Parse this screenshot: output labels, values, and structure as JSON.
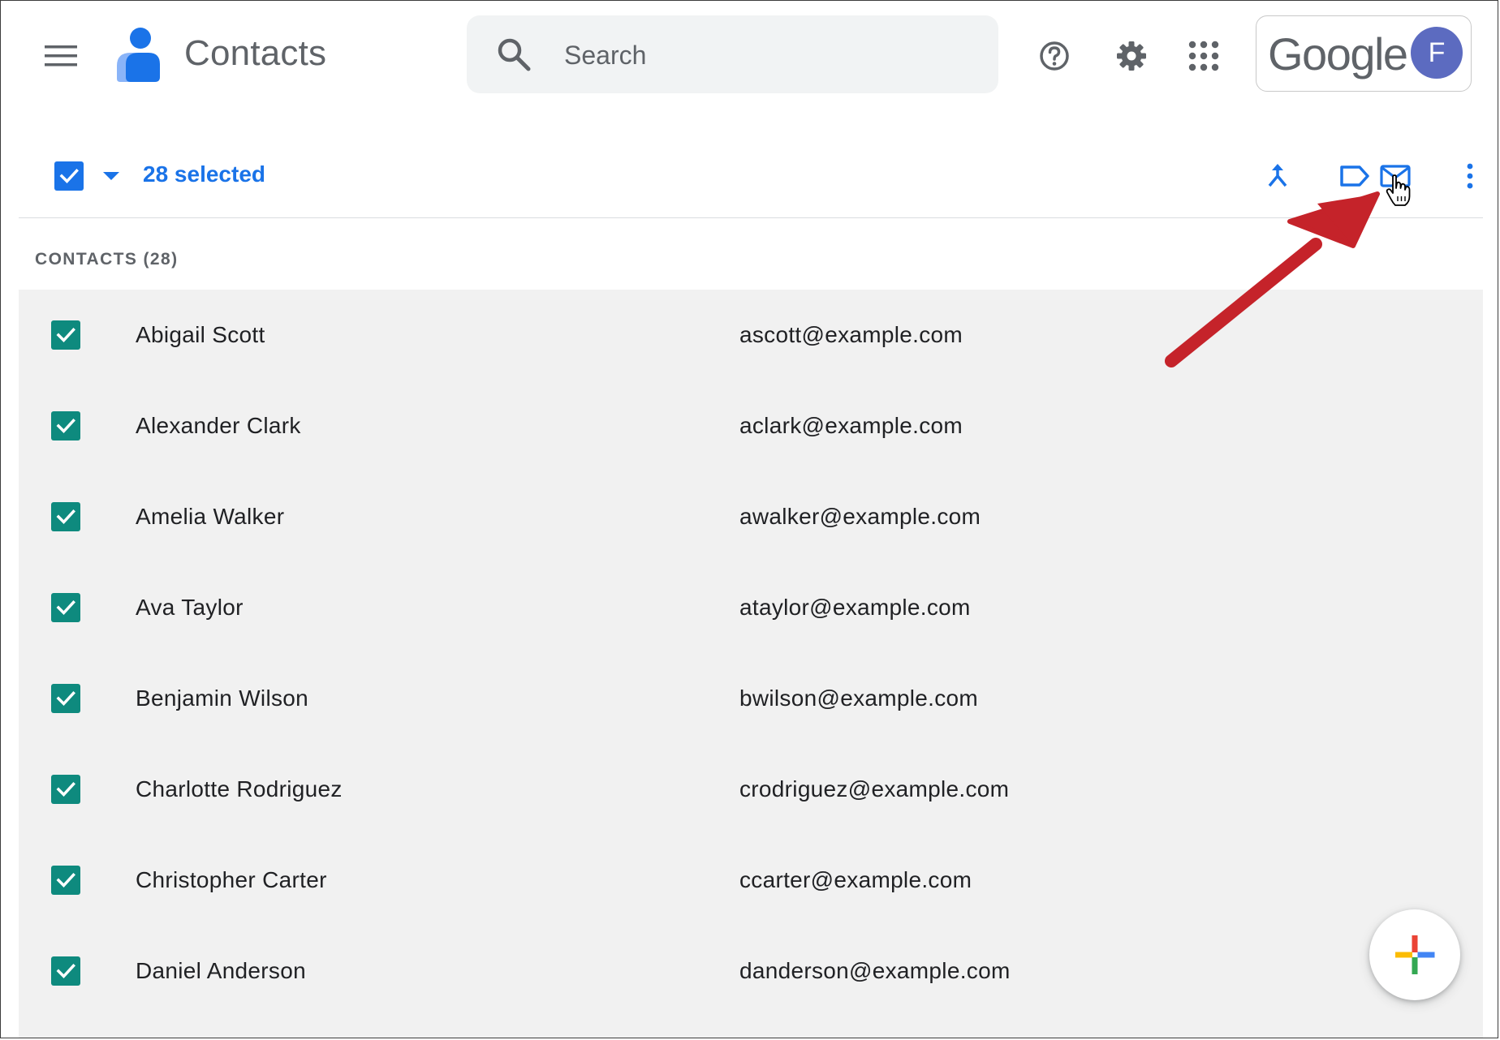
{
  "header": {
    "app_title": "Contacts",
    "brand_word": "Google",
    "avatar_initial": "F",
    "menu_icon": "hamburger-menu-icon",
    "logo_icon": "contacts-person-icon",
    "help_icon": "help-circle-icon",
    "settings_icon": "gear-icon",
    "apps_icon": "apps-grid-icon"
  },
  "search": {
    "placeholder": "Search",
    "value": ""
  },
  "selection": {
    "count_label": "28 selected",
    "actions": [
      "merge-icon",
      "label-icon",
      "email-icon",
      "more-vert-icon"
    ]
  },
  "section": {
    "title": "CONTACTS (28)"
  },
  "contacts": [
    {
      "name": "Abigail Scott",
      "email": "ascott@example.com"
    },
    {
      "name": "Alexander Clark",
      "email": "aclark@example.com"
    },
    {
      "name": "Amelia Walker",
      "email": "awalker@example.com"
    },
    {
      "name": "Ava Taylor",
      "email": "ataylor@example.com"
    },
    {
      "name": "Benjamin Wilson",
      "email": "bwilson@example.com"
    },
    {
      "name": "Charlotte Rodriguez",
      "email": "crodriguez@example.com"
    },
    {
      "name": "Christopher Carter",
      "email": "ccarter@example.com"
    },
    {
      "name": "Daniel Anderson",
      "email": "danderson@example.com"
    }
  ],
  "colors": {
    "accent": "#1a73e8",
    "row_check": "#0e8a7e",
    "list_bg": "#f1f1f1",
    "annotation": "#c5232a",
    "avatar_bg": "#5c6bc0"
  }
}
